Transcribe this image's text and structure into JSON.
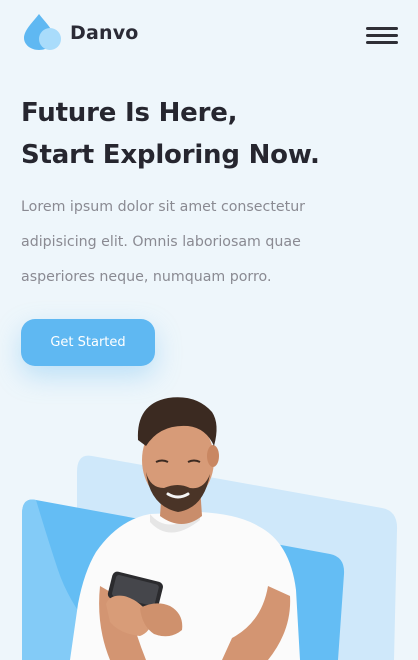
{
  "brand": {
    "name": "Danvo",
    "logo_icon": "water-drop-logo-icon",
    "accent_color": "#5fb8f2",
    "accent_light": "#a9dcfb"
  },
  "nav": {
    "menu_icon": "hamburger-menu-icon"
  },
  "hero": {
    "title_lines": [
      "Future Is Here,",
      "Start Exploring Now."
    ],
    "description_lines": [
      "Lorem ipsum dolor sit amet consectetur",
      "adipisicing elit. Omnis laboriosam quae",
      "asperiores neque, numquam porro."
    ],
    "cta_label": "Get Started",
    "image": "man-with-smartphone-illustration"
  },
  "colors": {
    "background": "#eef6fb",
    "heading": "#26262f",
    "body_text": "#8a8a92",
    "panel_dark": "#64bdf4",
    "panel_light": "#cfe8fa"
  }
}
